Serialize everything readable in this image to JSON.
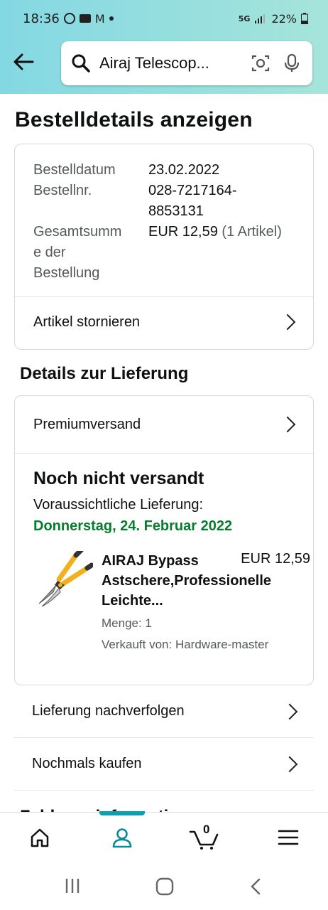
{
  "status_bar": {
    "time": "18:36",
    "battery": "22%",
    "network": "5G"
  },
  "search": {
    "query": "Airaj Telescop..."
  },
  "page": {
    "title": "Bestelldetails anzeigen"
  },
  "order": {
    "date_label": "Bestelldatum",
    "date_value": "23.02.2022",
    "number_label": "Bestellnr.",
    "number_value_line1": "028-7217164-",
    "number_value_line2": "8853131",
    "total_label_line1": "Gesamtsumm",
    "total_label_line2": "e der",
    "total_label_line3": "Bestellung",
    "total_value": "EUR 12,59",
    "total_items": "(1 Artikel)",
    "cancel_label": "Artikel stornieren"
  },
  "delivery": {
    "section_title": "Details zur Lieferung",
    "shipping_method": "Premiumversand",
    "status": "Noch nicht versandt",
    "estimate_label": "Voraussichtliche Lieferung:",
    "estimate_date": "Donnerstag, 24. Februar 2022",
    "accent_color": "#067d2c"
  },
  "product": {
    "name_line1": "AIRAJ Bypass",
    "name_line2": "Astschere,Professionelle",
    "name_line3": "Leichte...",
    "price": "EUR 12,59",
    "quantity": "Menge: 1",
    "seller": "Verkauft von: Hardware-master"
  },
  "actions": {
    "track_label": "Lieferung nachverfolgen",
    "buy_again_label": "Nochmals kaufen"
  },
  "peek_heading": "Zahlungsinformationen",
  "bottom_nav": {
    "cart_count": "0",
    "active": "account"
  }
}
